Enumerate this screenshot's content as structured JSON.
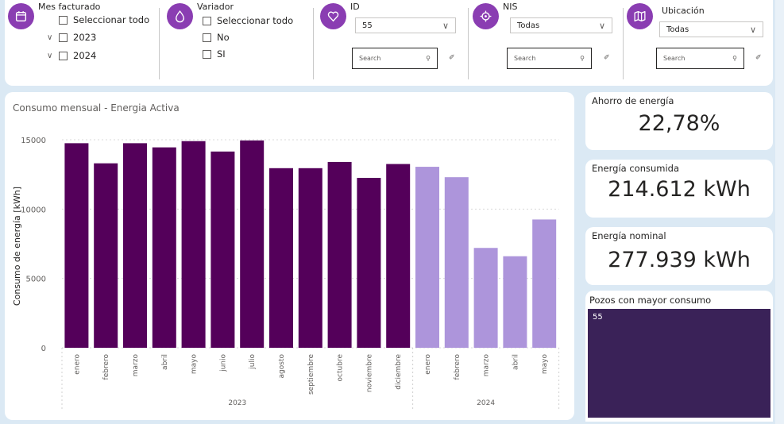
{
  "filters": {
    "mes_facturado": {
      "title": "Mes facturado",
      "options": [
        "Seleccionar todo",
        "2023",
        "2024"
      ]
    },
    "variador": {
      "title": "Variador",
      "options": [
        "Seleccionar todo",
        "No",
        "SI"
      ]
    },
    "id": {
      "title": "ID",
      "selected": "55",
      "search_placeholder": "Search"
    },
    "nis": {
      "title": "NIS",
      "selected": "Todas",
      "search_placeholder": "Search"
    },
    "ubicacion": {
      "title": "Ubicación",
      "selected": "Todas",
      "search_placeholder": "Search"
    }
  },
  "chart_data": {
    "type": "bar",
    "title": "Consumo mensual - Energia Activa",
    "ylabel": "Consumo de energía [kWh]",
    "xlabel": "",
    "ylim": [
      0,
      15000
    ],
    "yticks": [
      0,
      5000,
      10000,
      15000
    ],
    "grid": true,
    "colors": {
      "2023": "#54005a",
      "2024": "#ad95db"
    },
    "categories": [
      "enero",
      "febrero",
      "marzo",
      "abril",
      "mayo",
      "junio",
      "julio",
      "agosto",
      "septiembre",
      "octubre",
      "noviembre",
      "diciembre",
      "enero",
      "febrero",
      "marzo",
      "abril",
      "mayo"
    ],
    "groups": [
      {
        "name": "2023",
        "start": 0,
        "count": 12
      },
      {
        "name": "2024",
        "start": 12,
        "count": 5
      }
    ],
    "values": [
      14750,
      13300,
      14750,
      14450,
      14900,
      14150,
      14950,
      12950,
      12950,
      13400,
      12250,
      13250,
      13050,
      12300,
      7200,
      6600,
      9250
    ]
  },
  "kpis": [
    {
      "label": "Ahorro de energía",
      "value": "22,78%"
    },
    {
      "label": "Energía consumida",
      "value": "214.612 kWh"
    },
    {
      "label": "Energía nominal",
      "value": "277.939 kWh"
    }
  ],
  "treemap": {
    "title": "Pozos con mayor consumo",
    "cells": [
      {
        "label": "55",
        "color": "#3a2258"
      }
    ]
  }
}
